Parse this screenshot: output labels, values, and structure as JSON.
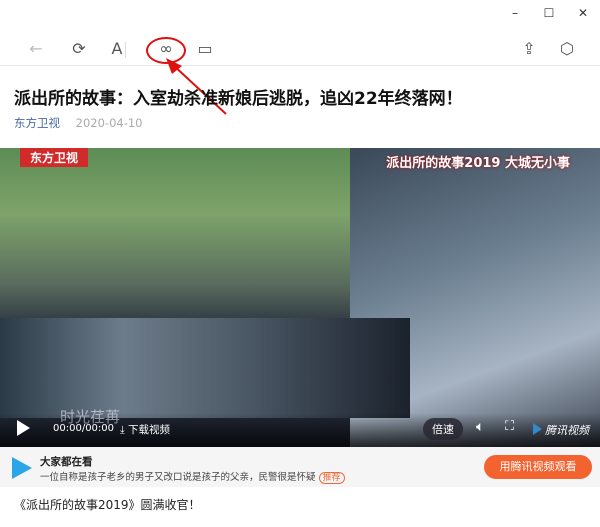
{
  "window": {
    "minimize": "–",
    "maximize": "☐",
    "close": "✕"
  },
  "toolbar": {
    "back": "←",
    "refresh": "⟳",
    "font": "A",
    "link": "∞",
    "window": "▭",
    "share": "⇪",
    "cube": "⬡"
  },
  "article": {
    "title": "派出所的故事：入室劫杀准新娘后逃脱，追凶22年终落网！",
    "source": "东方卫视",
    "date": "2020-04-10",
    "body": "《派出所的故事2019》圆满收官！"
  },
  "video": {
    "channel_logo": "东方卫视",
    "show_tag": "派出所的故事2019 大城无小事",
    "subtitle": "时光荏苒",
    "time": "00:00/00:00",
    "download": "下载视频",
    "speed": "倍速",
    "brand": "腾讯视频"
  },
  "promo": {
    "heading": "大家都在看",
    "text": "一位自称是孩子老乡的男子又改口说是孩子的父亲，民警很是怀疑",
    "badge": "推荐",
    "button": "用腾讯视频观看"
  }
}
